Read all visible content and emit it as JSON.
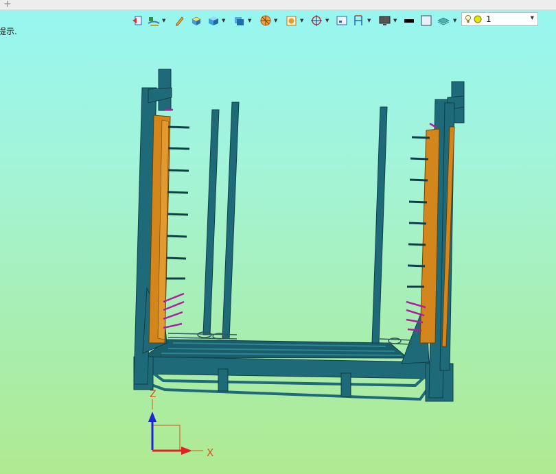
{
  "tabbar": {
    "add_tab_symbol": "+"
  },
  "hint_text": "提示.",
  "toolbar": {
    "icons": [
      "exit-sketch-icon",
      "sketch-filter-icon",
      "pencil-icon",
      "box-shade-icon",
      "solid-view-icon",
      "display-mode-icon",
      "render-style-icon",
      "section-view-icon",
      "view-orient-icon",
      "frame-icon",
      "dimension-icon",
      "monitor-icon",
      "color-swatch-black-icon",
      "color-swatch-white-icon",
      "layer-stack-icon"
    ],
    "layer_select": {
      "bulb_icon": "lightbulb-icon",
      "dot_color": "#e6e600",
      "value": "1"
    }
  },
  "model": {
    "frame_color": "#1f6a78",
    "panel_color": "#d2861c",
    "accent_color": "#b01ea0"
  },
  "triad": {
    "z_label": "Z",
    "x_label": "X",
    "z_color": "#1b27d6",
    "x_color": "#e02222"
  }
}
